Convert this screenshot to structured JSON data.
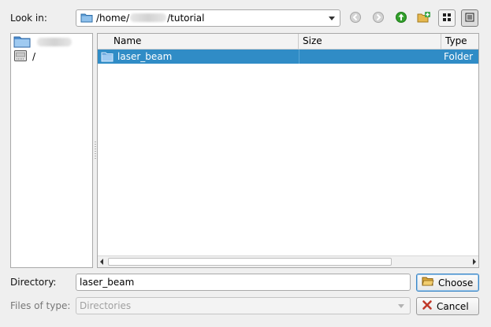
{
  "look_in": {
    "label": "Look in:",
    "path_prefix": "/home/",
    "path_user": "stefano",
    "path_suffix": "/tutorial"
  },
  "toolbar": {
    "back": "back-icon",
    "forward": "forward-icon",
    "up": "parent-directory-icon",
    "new_folder": "new-folder-icon",
    "list_view": "list-view-icon",
    "detail_view": "detail-view-icon"
  },
  "sidebar": {
    "items": [
      {
        "label": "stefano",
        "icon": "home-folder-icon"
      },
      {
        "label": "/",
        "icon": "drive-icon"
      }
    ]
  },
  "file_list": {
    "columns": [
      "Name",
      "Size",
      "Type"
    ],
    "rows": [
      {
        "name": "laser_beam",
        "size": "",
        "type": "Folder"
      }
    ]
  },
  "directory": {
    "label": "Directory:",
    "value": "laser_beam"
  },
  "files_of_type": {
    "label": "Files of type:",
    "value": "Directories"
  },
  "buttons": {
    "choose": "Choose",
    "cancel": "Cancel"
  },
  "colors": {
    "selection": "#308cc6",
    "up_arrow": "#2e9a2e",
    "cancel_x": "#c0392b"
  }
}
